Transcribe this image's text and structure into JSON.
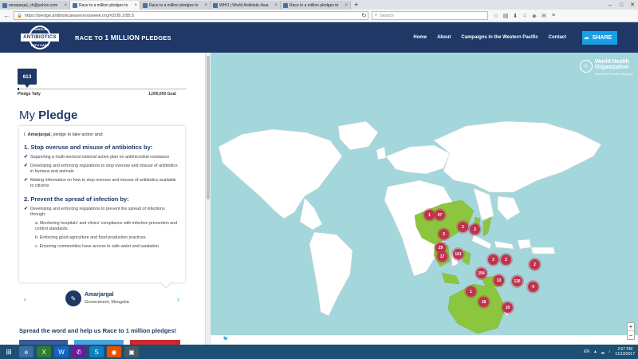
{
  "browser": {
    "tabs": [
      {
        "title": "amarjargal_ch@yahoo.com",
        "active": false
      },
      {
        "title": "Race to a million pledges to",
        "active": true
      },
      {
        "title": "Race to a million pledges to",
        "active": false
      },
      {
        "title": "WHO | World Antibiotic Awa",
        "active": false
      },
      {
        "title": "Race to a million pledges to",
        "active": false
      }
    ],
    "new_tab_label": "+",
    "url": "https://pledge.antibioticawarenessweek.org/#2/38.1/85.5",
    "search_placeholder": "Search"
  },
  "header": {
    "logo_top": "HANDLE",
    "logo_main": "ANTIBIOTICS",
    "logo_bottom": "WITH CARE",
    "title_prefix": "RACE TO ",
    "title_bold": "1 MILLION",
    "title_suffix": " PLEDGES",
    "nav": [
      {
        "label": "Home"
      },
      {
        "label": "About"
      },
      {
        "label": "Campaigns in the Western Pacific"
      },
      {
        "label": "Contact"
      }
    ],
    "share_label": "SHARE"
  },
  "tally": {
    "count": "613",
    "progress_fraction": 0.000613,
    "label": "Pledge Tally",
    "goal": "1,000,000 Goal"
  },
  "pledge": {
    "heading_light": "My ",
    "heading_bold": "Pledge",
    "intro_prefix": "I, ",
    "intro_name": "Amarjargal",
    "intro_suffix": ", pledge to take action and:",
    "section1_title": "1. Stop overuse and misuse of antibiotics by:",
    "section1_items": [
      "Supporting a multi-sectoral national action plan on antimicrobial resistance",
      "Developing and enforcing regulations to stop overuse and misuse of antibiotics in humans and animals",
      "Making information on how to stop overuse and misuse of antibiotics available to citizens"
    ],
    "section2_title": "2. Prevent the spread of infection by:",
    "section2_item": "Developing and enforcing regulations to prevent the spread of infections through:",
    "section2_subitems": [
      "a. Monitoring hospitals' and clinics' compliance with infection prevention and control standards",
      "b. Enforcing good agriculture and food production practices",
      "c. Ensuring communities have access to safe water and sanitation"
    ]
  },
  "profile": {
    "name": "Amarjargal",
    "org": "Government, Mongolia"
  },
  "spread_text": "Spread the word and help us Race to 1 million pledges!",
  "who_logo": {
    "line1": "World Health",
    "line2": "Organization",
    "region": "Western Pacific Region"
  },
  "map_markers": [
    {
      "label": "1"
    },
    {
      "label": "97"
    },
    {
      "label": "2"
    },
    {
      "label": "3"
    },
    {
      "label": "3"
    },
    {
      "label": "29"
    },
    {
      "label": "17"
    },
    {
      "label": "101"
    },
    {
      "label": "2"
    },
    {
      "label": "2"
    },
    {
      "label": "2"
    },
    {
      "label": "154"
    },
    {
      "label": "13"
    },
    {
      "label": "136"
    },
    {
      "label": "4"
    },
    {
      "label": "1"
    },
    {
      "label": "18"
    },
    {
      "label": "10"
    }
  ],
  "map_footer": {
    "copyright": "© WPRO 2017 · All Rights Reserved",
    "privacy": "Privacy Policy",
    "disclaimer": "Disclaimer"
  },
  "zoom": {
    "in": "+",
    "out": "−"
  },
  "taskbar": {
    "lang": "EN",
    "time": "2:57 PM",
    "date": "11/13/2017"
  },
  "colors": {
    "navy": "#1f3866",
    "accent_blue": "#1b9fe4",
    "ocean": "#a3d7dc",
    "land": "#ffffff",
    "highlight_land": "#8cc63f",
    "marker": "#c0334d"
  }
}
